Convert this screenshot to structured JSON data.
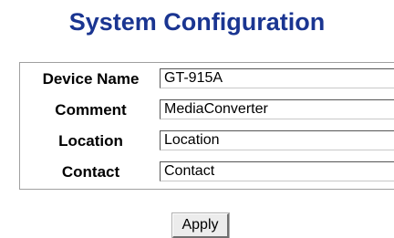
{
  "page": {
    "title": "System Configuration"
  },
  "form": {
    "fields": [
      {
        "label": "Device Name",
        "value": "GT-915A"
      },
      {
        "label": "Comment",
        "value": "MediaConverter"
      },
      {
        "label": "Location",
        "value": "Location"
      },
      {
        "label": "Contact",
        "value": "Contact"
      }
    ],
    "apply_label": "Apply"
  },
  "colors": {
    "title": "#1a3591",
    "border": "#a0a0a0",
    "background": "#ffffff"
  }
}
